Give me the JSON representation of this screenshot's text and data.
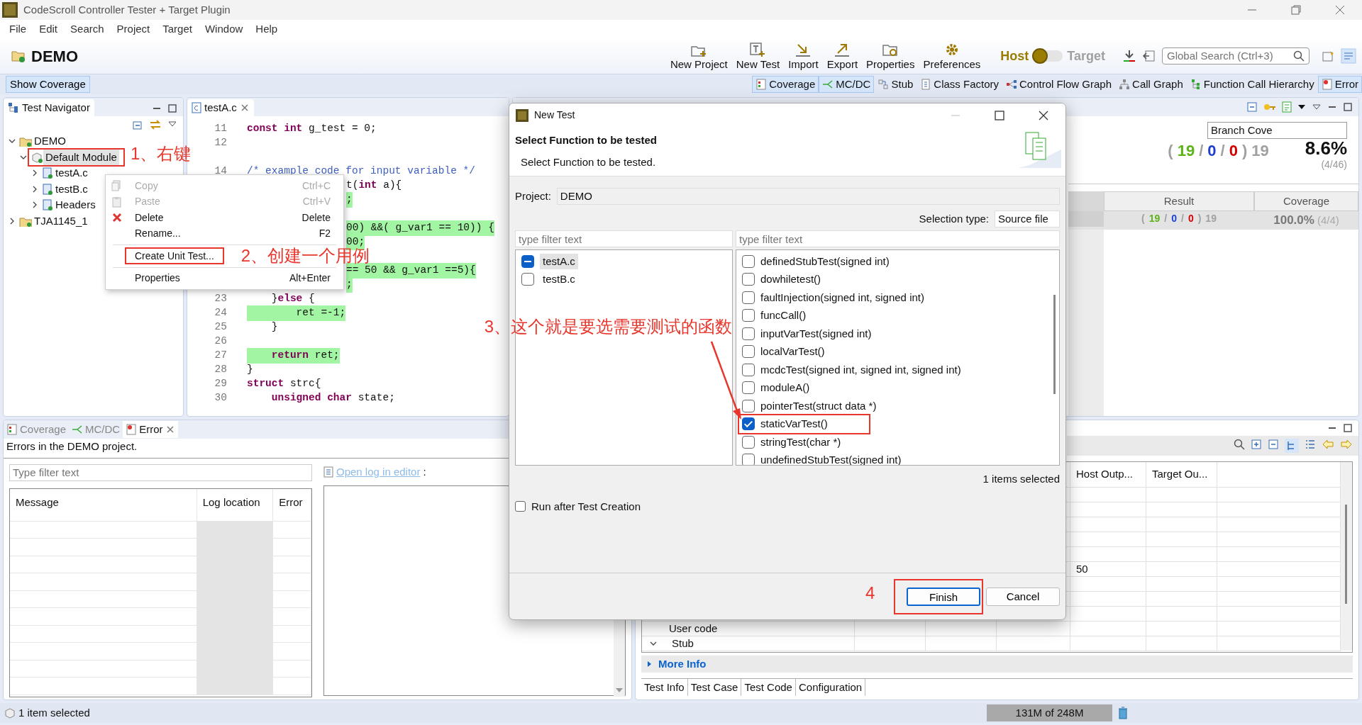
{
  "window": {
    "title": "CodeScroll Controller Tester + Target Plugin"
  },
  "menu": [
    "File",
    "Edit",
    "Search",
    "Project",
    "Target",
    "Window",
    "Help"
  ],
  "project_title": "DEMO",
  "toolbar": [
    {
      "label": "New Project"
    },
    {
      "label": "New Test"
    },
    {
      "label": "Import"
    },
    {
      "label": "Export"
    },
    {
      "label": "Properties"
    },
    {
      "label": "Preferences"
    }
  ],
  "mode_switch": {
    "host": "Host",
    "target": "Target",
    "target_selected": false
  },
  "global_search": {
    "placeholder": "Global Search (Ctrl+3)"
  },
  "show_coverage": "Show Coverage",
  "perspectives": [
    {
      "label": "Coverage",
      "selected": true
    },
    {
      "label": "MC/DC",
      "selected": true
    },
    {
      "label": "Stub",
      "selected": false
    },
    {
      "label": "Class Factory",
      "selected": false
    },
    {
      "label": "Control Flow Graph",
      "selected": false
    },
    {
      "label": "Call Graph",
      "selected": false
    },
    {
      "label": "Function Call Hierarchy",
      "selected": false
    },
    {
      "label": "Error",
      "selected": true
    }
  ],
  "navigator": {
    "title": "Test Navigator",
    "tree": [
      {
        "label": "DEMO",
        "expanded": true,
        "selected": false,
        "children": [
          {
            "label": "Default Module",
            "expanded": true,
            "selected": true,
            "children": [
              {
                "label": "testA.c",
                "expanded": false,
                "selected": false
              },
              {
                "label": "testB.c",
                "expanded": false,
                "selected": false
              },
              {
                "label": "Headers",
                "expanded": false,
                "selected": false
              }
            ]
          }
        ]
      },
      {
        "label": "TJA1145_1",
        "expanded": false,
        "selected": false
      }
    ]
  },
  "editor": {
    "tab": "testA.c",
    "lines": [
      {
        "kind": "full",
        "number": "11",
        "code": "**const** **int** g_test = 0;",
        "highlighted": false
      },
      {
        "kind": "full",
        "number": "12",
        "highlighted": false
      },
      {
        "kind": "full",
        "highlighted": false
      },
      {
        "kind": "comment",
        "number": "14",
        "code": "/* example code for input variable */",
        "highlighted": false
      },
      {
        "kind": "fragment",
        "code": "t(**int** a){",
        "highlighted": false
      },
      {
        "kind": "fragment",
        "code": ";",
        "highlighted": true
      },
      {
        "kind": "fragment",
        "highlighted": false
      },
      {
        "kind": "fragment",
        "code": "00) &&( g_var1 == 10)) {",
        "highlighted": true
      },
      {
        "kind": "fragment",
        "code": "00;",
        "highlighted": true
      },
      {
        "kind": "fragment",
        "highlighted": false
      },
      {
        "kind": "fragment",
        "code": "== 50 && g_var1 ==5){",
        "highlighted": true
      },
      {
        "kind": "fragment",
        "code": ";",
        "highlighted": true
      },
      {
        "kind": "full",
        "number": "23",
        "code": "    }**else** {",
        "highlighted": false
      },
      {
        "kind": "full",
        "number": "24",
        "code": "        ret =-1;",
        "highlighted": true
      },
      {
        "kind": "full",
        "number": "25",
        "code": "    }",
        "highlighted": false
      },
      {
        "kind": "full",
        "number": "26",
        "highlighted": false
      },
      {
        "kind": "full",
        "number": "27",
        "code": "    **return** ret;",
        "highlighted": true
      },
      {
        "kind": "full",
        "number": "28",
        "code": "}",
        "highlighted": false
      },
      {
        "kind": "full",
        "number": "29",
        "code": "**struct** strc{",
        "highlighted": false
      },
      {
        "kind": "full",
        "number": "30",
        "code": "    **unsigned** **char** state;",
        "highlighted": false
      }
    ]
  },
  "context_menu": [
    {
      "kind": "copy",
      "label": "Copy",
      "shortcut": "Ctrl+C",
      "disabled": true
    },
    {
      "kind": "paste",
      "label": "Paste",
      "shortcut": "Ctrl+V",
      "disabled": true
    },
    {
      "kind": "delete",
      "label": "Delete",
      "shortcut": "Delete",
      "disabled": false
    },
    {
      "kind": "plain",
      "label": "Rename...",
      "shortcut": "F2",
      "disabled": false
    },
    {
      "kind": "separator"
    },
    {
      "kind": "plain",
      "label": "Create Unit Test...",
      "disabled": false
    },
    {
      "kind": "separator"
    },
    {
      "kind": "plain",
      "label": "Properties",
      "shortcut": "Alt+Enter",
      "disabled": false
    }
  ],
  "coverage_summary": {
    "selector": "Branch Cove",
    "counts": [
      {
        "text": "(",
        "color": "#a0a0a0"
      },
      {
        "text": "19",
        "color": "#5cb318"
      },
      {
        "text": "/",
        "color": "#a0a0a0"
      },
      {
        "text": "0",
        "color": "#1c3fd1"
      },
      {
        "text": "/",
        "color": "#a0a0a0"
      },
      {
        "text": "0",
        "color": "#d40000"
      },
      {
        "text": ")",
        "color": "#a0a0a0"
      },
      {
        "text": "19",
        "color": "#a0a0a0"
      }
    ],
    "percent": "8.6%",
    "ratio": "(4/46)"
  },
  "result_table": {
    "columns": [
      "Result",
      "Coverage"
    ],
    "counts": [
      {
        "text": "(",
        "color": "#a0a0a0"
      },
      {
        "text": "19",
        "color": "#5cb318"
      },
      {
        "text": "/",
        "color": "#a0a0a0"
      },
      {
        "text": "0",
        "color": "#1c3fd1"
      },
      {
        "text": "/",
        "color": "#a0a0a0"
      },
      {
        "text": "0",
        "color": "#d40000"
      },
      {
        "text": ")",
        "color": "#a0a0a0"
      },
      {
        "text": "19",
        "color": "#a0a0a0"
      }
    ],
    "coverage": "100.0%",
    "ratio": "(4/4)"
  },
  "error_view": {
    "tabs": [
      {
        "label": "Coverage",
        "selected": false
      },
      {
        "label": "MC/DC",
        "selected": false
      },
      {
        "label": "Error",
        "selected": true
      }
    ],
    "heading": "Errors in the DEMO project.",
    "filter": {
      "placeholder": "Type filter text"
    },
    "columns": [
      "Message",
      "Log location",
      "Error"
    ],
    "link": "Open log in editor",
    "link_suffix": ":"
  },
  "test_detail": {
    "columns": [
      "Host Outp...",
      "Target Ou..."
    ],
    "rows": [
      {},
      {},
      {},
      {},
      {},
      {
        "host_output": "50"
      },
      {},
      {},
      {},
      {
        "name": "User code"
      },
      {
        "name": "Stub",
        "expanded": true
      }
    ],
    "more_info": "More Info",
    "tabs": [
      "Test Info",
      "Test Case",
      "Test Code",
      "Configuration"
    ]
  },
  "dialog": {
    "title": "New Test",
    "heading": "Select Function to be tested",
    "description": "Select Function to be tested.",
    "project_label": "Project:",
    "project": "DEMO",
    "selection_type_label": "Selection type:",
    "selection_type": "Source file",
    "file_filter": {
      "placeholder": "type filter text"
    },
    "function_filter": {
      "placeholder": "type filter text"
    },
    "files": [
      {
        "label": "testA.c",
        "partial": true,
        "selected": true
      },
      {
        "label": "testB.c",
        "partial": false,
        "selected": false
      }
    ],
    "functions": [
      {
        "label": "definedStubTest(signed int)",
        "checked": false
      },
      {
        "label": "dowhiletest()",
        "checked": false
      },
      {
        "label": "faultInjection(signed int, signed int)",
        "checked": false
      },
      {
        "label": "funcCall()",
        "checked": false
      },
      {
        "label": "inputVarTest(signed int)",
        "checked": false
      },
      {
        "label": "localVarTest()",
        "checked": false
      },
      {
        "label": "mcdcTest(signed int, signed int, signed int)",
        "checked": false
      },
      {
        "label": "moduleA()",
        "checked": false
      },
      {
        "label": "pointerTest(struct data *)",
        "checked": false
      },
      {
        "label": "staticVarTest()",
        "checked": true
      },
      {
        "label": "stringTest(char *)",
        "checked": false
      },
      {
        "label": "undefinedStubTest(signed int)",
        "checked": false
      }
    ],
    "summary": "1 items selected",
    "run_after": {
      "label": "Run after Test Creation",
      "checked": false
    },
    "buttons": [
      {
        "label": "Finish",
        "default": true
      },
      {
        "label": "Cancel",
        "default": false
      }
    ]
  },
  "annotations": [
    "1、右键",
    "2、创建一个用例",
    "3、这个就是要选需要测试的函数",
    "4"
  ],
  "status_bar": {
    "message": "1 item selected",
    "memory": "131M of 248M"
  }
}
